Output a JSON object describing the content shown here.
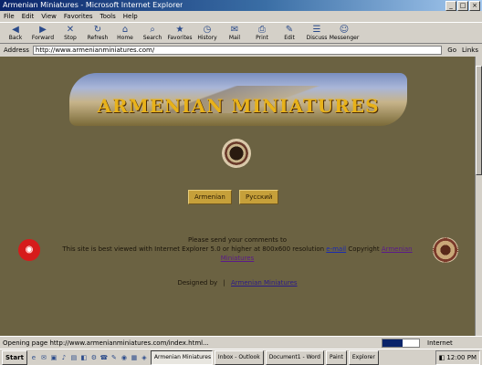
{
  "window": {
    "title": "Armenian Miniatures - Microsoft Internet Explorer",
    "controls": [
      "_",
      "□",
      "×"
    ]
  },
  "menubar": [
    "File",
    "Edit",
    "View",
    "Favorites",
    "Tools",
    "Help"
  ],
  "toolbar": [
    {
      "label": "Back",
      "icon": "back-arrow-icon",
      "glyph": "◀"
    },
    {
      "label": "Forward",
      "icon": "forward-arrow-icon",
      "glyph": "▶"
    },
    {
      "label": "Stop",
      "icon": "stop-icon",
      "glyph": "✕"
    },
    {
      "label": "Refresh",
      "icon": "refresh-icon",
      "glyph": "↻"
    },
    {
      "label": "Home",
      "icon": "home-icon",
      "glyph": "⌂"
    },
    {
      "label": "Search",
      "icon": "search-icon",
      "glyph": "⌕"
    },
    {
      "label": "Favorites",
      "icon": "favorites-icon",
      "glyph": "★"
    },
    {
      "label": "History",
      "icon": "history-icon",
      "glyph": "◷"
    },
    {
      "label": "Mail",
      "icon": "mail-icon",
      "glyph": "✉"
    },
    {
      "label": "Print",
      "icon": "print-icon",
      "glyph": "⎙"
    },
    {
      "label": "Edit",
      "icon": "edit-icon",
      "glyph": "✎"
    },
    {
      "label": "Discuss",
      "icon": "discuss-icon",
      "glyph": "☰"
    },
    {
      "label": "Messenger",
      "icon": "messenger-icon",
      "glyph": "☺"
    }
  ],
  "address": {
    "label": "Address",
    "value": "http://www.armenianminiatures.com/",
    "go": "Go",
    "links": "Links"
  },
  "page": {
    "banner_title": "ARMENIAN MINIATURES",
    "nav": [
      {
        "label": "Armenian",
        "x": 0
      },
      {
        "label": "Русский"
      }
    ],
    "info_line1": "Please send your comments to",
    "info_line2a": "This site is best viewed with Internet Explorer 5.0 or higher at 800x600 resolution",
    "info_line2_link": "e-mail",
    "info_line2b": "Copyright",
    "info_line2_link2": "Armenian Miniatures",
    "footer_left": "Designed by",
    "footer_right": "Armenian Miniatures"
  },
  "status": {
    "text": "Opening page http://www.armenianminiatures.com/index.html...",
    "progress": 0.55,
    "zone": "Internet"
  },
  "taskbar": {
    "start": "Start",
    "quick": [
      "e",
      "✉",
      "▣",
      "♪",
      "▤",
      "◧",
      "⚙",
      "☎",
      "✎",
      "◉",
      "▦",
      "◈"
    ],
    "tasks": [
      {
        "label": "Armenian Miniatures",
        "active": true
      },
      {
        "label": "Inbox - Outlook"
      },
      {
        "label": "Document1 - Word"
      },
      {
        "label": "Paint"
      },
      {
        "label": "Explorer"
      }
    ],
    "clock": "12:00 PM"
  }
}
